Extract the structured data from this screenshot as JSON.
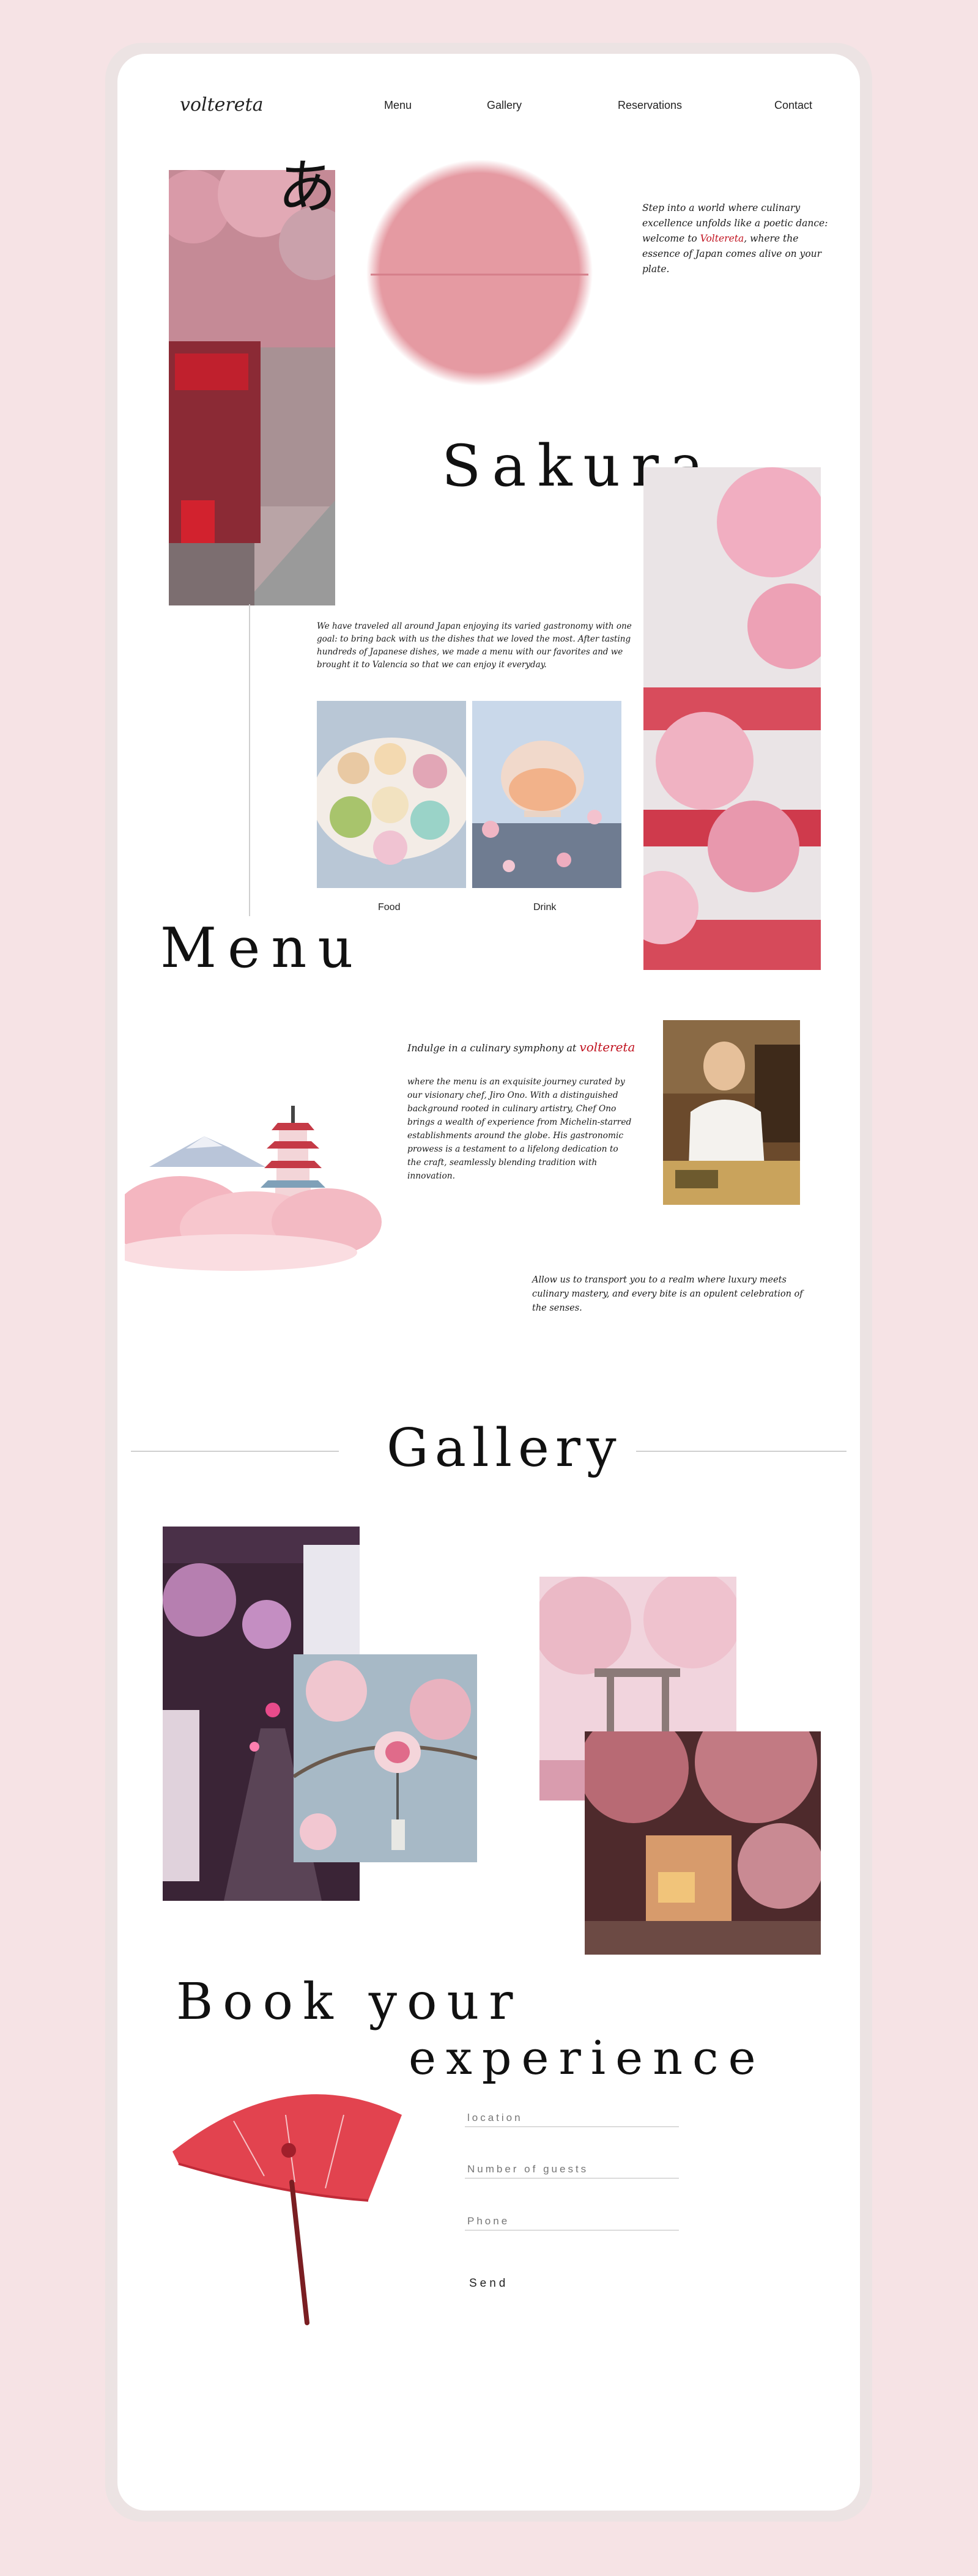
{
  "brand": {
    "logo": "voltereta"
  },
  "nav": {
    "items": [
      "Menu",
      "Gallery",
      "Reservations",
      "Contact"
    ]
  },
  "hero": {
    "kana": "あ",
    "intro": "Step into a world where culinary excellence unfolds like a poetic dance: welcome to Voltereta, where the essence of Japan comes alive on your plate.",
    "title": "Sakura"
  },
  "about": {
    "text": "We have traveled all around Japan enjoying its varied gastronomy with one goal: to bring back with us the dishes that we loved the most. After tasting hundreds of Japanese dishes, we made a menu with our favorites and we brought it to Valencia so that we can enjoy it everyday.",
    "tiles": [
      "Food",
      "Drink"
    ]
  },
  "menu": {
    "title": "Menu",
    "lead_prefix": "Indulge in a culinary symphony at ",
    "lead_brand": "voltereta",
    "body": "where the menu is an exquisite journey curated by our visionary chef, Jiro Ono. With a distinguished background rooted in culinary artistry, Chef Ono brings a wealth of experience from Michelin-starred establishments around the globe. His gastronomic prowess is a testament to a lifelong dedication to the craft, seamlessly blending tradition with innovation.",
    "closing": "Allow us to transport you to a realm where luxury meets culinary mastery, and every bite is an opulent celebration of the senses."
  },
  "gallery": {
    "title": "Gallery"
  },
  "booking": {
    "title_line1": "Book your",
    "title_line2": "experience",
    "fields": [
      "location",
      "Number of guests",
      "Phone"
    ],
    "send": "Send"
  },
  "colors": {
    "accent": "#c1121f",
    "pink": "#e8a0a8",
    "background": "#f6e3e5"
  }
}
